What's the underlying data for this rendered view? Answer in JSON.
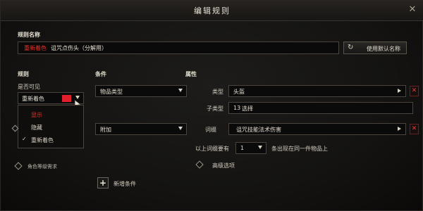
{
  "window": {
    "title": "编辑规则",
    "close_icon": "close-icon"
  },
  "rule_name": {
    "label": "规则名称",
    "prefix": "重新着色",
    "value": "诅咒点伤头（分解用）",
    "reset_button": "使用默认名称"
  },
  "sections": {
    "rules": "规则",
    "conditions": "条件",
    "properties": "属性"
  },
  "visibility": {
    "label": "是否可见",
    "selected": "重新着色",
    "color": "#e01f2a",
    "options": [
      {
        "label": "显示",
        "highlight": true
      },
      {
        "label": "隐藏",
        "highlight": false
      },
      {
        "label": "重新着色",
        "checked": true
      }
    ]
  },
  "tier_requirement": {
    "label": "角色等级需求"
  },
  "conditions": {
    "condition_1": "物品类型",
    "condition_2": "附加",
    "add_button": "新增条件"
  },
  "properties": {
    "type_label": "类型",
    "type_value": "头盔",
    "subtype_label": "子类型",
    "subtype_count": "13",
    "subtype_value": "选择",
    "affix_label": "词缀",
    "affix_value": "诅咒技能法术伤害",
    "affix_min_label": "以上词缀要有",
    "affix_min_value": "1",
    "affix_min_suffix": "条出现在同一件物品上",
    "advanced_label": "高级选项"
  },
  "colors": {
    "accent_red": "#e0332b",
    "background": "#141312",
    "border": "#4a443c"
  }
}
